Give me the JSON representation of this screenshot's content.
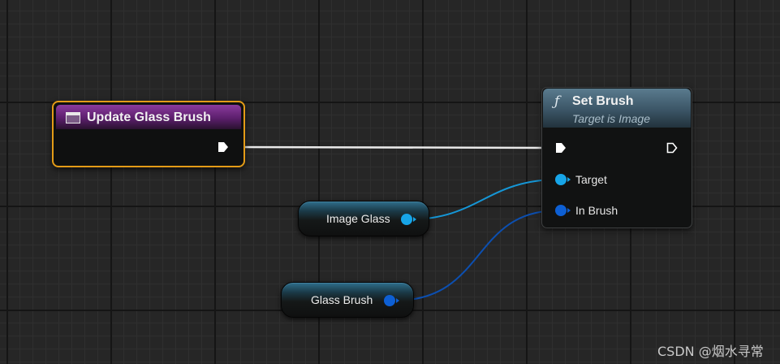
{
  "event_node": {
    "title": "Update Glass Brush",
    "header_color": "#7a3590",
    "border_color": "#e39b17",
    "icon": "event-graph-icon"
  },
  "function_node": {
    "icon_glyph": "ƒ",
    "title": "Set Brush",
    "subtitle": "Target is Image",
    "header_color": "#4d6a7c",
    "pins": {
      "target": {
        "label": "Target",
        "color": "#17a5e8"
      },
      "in_brush": {
        "label": "In Brush",
        "color": "#0d5fd4"
      }
    }
  },
  "variables": {
    "image_glass": {
      "label": "Image Glass",
      "pin_color": "#17a5e8"
    },
    "glass_brush": {
      "label": "Glass Brush",
      "pin_color": "#0d5fd4"
    }
  },
  "watermark": "CSDN @烟水寻常"
}
